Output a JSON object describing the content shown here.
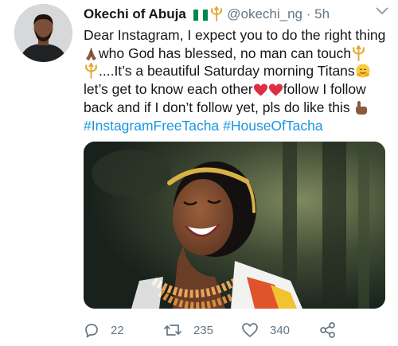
{
  "tweet": {
    "display_name": "Okechi of Abuja",
    "handle": "@okechi_ng",
    "dot": "·",
    "time": "5h",
    "text": {
      "line1": "Dear Instagram, I expect you to do the right thing",
      "line2": "who God has blessed, no man can touch",
      "line3": "....It’s a beautiful Saturday morning Titans",
      "line4": "let’s get to know each other",
      "line4b": "follow I follow",
      "line5": "back and if I don’t follow yet, pls do like this",
      "hashtag1": "#InstagramFreeTacha",
      "hashtag2": "#HouseOfTacha"
    },
    "counts": {
      "replies": "22",
      "retweets": "235",
      "likes": "340"
    }
  },
  "colors": {
    "link": "#1b95e0",
    "secondary_text": "#657786",
    "primary_text": "#14171a"
  },
  "icons": {
    "flag": "nigeria-flag-icon",
    "trident": "trident-icon",
    "prayer": "folded-hands-icon",
    "heart": "red-heart-icon",
    "hug": "hugging-face-icon",
    "point": "pointing-hand-icon",
    "chevron": "chevron-down-icon",
    "reply": "reply-icon",
    "retweet": "retweet-icon",
    "like": "like-icon",
    "share": "share-icon"
  }
}
